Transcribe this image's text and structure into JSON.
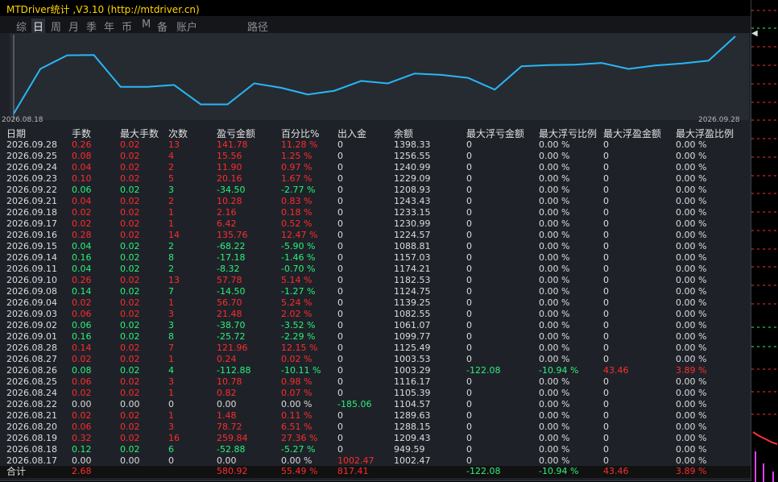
{
  "title": "MTDriver统计 ,V3.10 (http://mtdriver.cn)",
  "tabs": [
    "综",
    "日",
    "周",
    "月",
    "季",
    "年",
    "币",
    "M",
    "备",
    "账户",
    "路径"
  ],
  "active_tab": 1,
  "chart": {
    "date_start": "2026.08.18",
    "date_end": "2026.09.28",
    "line_color": "#29b6f6"
  },
  "colors": {
    "positive": "#ff2b2b",
    "negative": "#2cf07a",
    "neutral": "#dcdcdc"
  },
  "columns": [
    "日期",
    "手数",
    "最大手数",
    "次数",
    "盈亏金额",
    "百分比%",
    "出入金",
    "余额",
    "最大浮亏金额",
    "最大浮亏比例",
    "最大浮盈金额",
    "最大浮盈比例"
  ],
  "rows": [
    [
      "2026.09.28",
      "0.26",
      "0.02",
      "13",
      "141.78",
      "11.28 %",
      "0",
      "1398.33",
      "0",
      "0.00 %",
      "0",
      "0.00 %"
    ],
    [
      "2026.09.25",
      "0.08",
      "0.02",
      "4",
      "15.56",
      "1.25 %",
      "0",
      "1256.55",
      "0",
      "0.00 %",
      "0",
      "0.00 %"
    ],
    [
      "2026.09.24",
      "0.04",
      "0.02",
      "2",
      "11.90",
      "0.97 %",
      "0",
      "1240.99",
      "0",
      "0.00 %",
      "0",
      "0.00 %"
    ],
    [
      "2026.09.23",
      "0.10",
      "0.02",
      "5",
      "20.16",
      "1.67 %",
      "0",
      "1229.09",
      "0",
      "0.00 %",
      "0",
      "0.00 %"
    ],
    [
      "2026.09.22",
      "0.06",
      "0.02",
      "3",
      "-34.50",
      "-2.77 %",
      "0",
      "1208.93",
      "0",
      "0.00 %",
      "0",
      "0.00 %"
    ],
    [
      "2026.09.21",
      "0.04",
      "0.02",
      "2",
      "10.28",
      "0.83 %",
      "0",
      "1243.43",
      "0",
      "0.00 %",
      "0",
      "0.00 %"
    ],
    [
      "2026.09.18",
      "0.02",
      "0.02",
      "1",
      "2.16",
      "0.18 %",
      "0",
      "1233.15",
      "0",
      "0.00 %",
      "0",
      "0.00 %"
    ],
    [
      "2026.09.17",
      "0.02",
      "0.02",
      "1",
      "6.42",
      "0.52 %",
      "0",
      "1230.99",
      "0",
      "0.00 %",
      "0",
      "0.00 %"
    ],
    [
      "2026.09.16",
      "0.28",
      "0.02",
      "14",
      "135.76",
      "12.47 %",
      "0",
      "1224.57",
      "0",
      "0.00 %",
      "0",
      "0.00 %"
    ],
    [
      "2026.09.15",
      "0.04",
      "0.02",
      "2",
      "-68.22",
      "-5.90 %",
      "0",
      "1088.81",
      "0",
      "0.00 %",
      "0",
      "0.00 %"
    ],
    [
      "2026.09.14",
      "0.16",
      "0.02",
      "8",
      "-17.18",
      "-1.46 %",
      "0",
      "1157.03",
      "0",
      "0.00 %",
      "0",
      "0.00 %"
    ],
    [
      "2026.09.11",
      "0.04",
      "0.02",
      "2",
      "-8.32",
      "-0.70 %",
      "0",
      "1174.21",
      "0",
      "0.00 %",
      "0",
      "0.00 %"
    ],
    [
      "2026.09.10",
      "0.26",
      "0.02",
      "13",
      "57.78",
      "5.14 %",
      "0",
      "1182.53",
      "0",
      "0.00 %",
      "0",
      "0.00 %"
    ],
    [
      "2026.09.08",
      "0.14",
      "0.02",
      "7",
      "-14.50",
      "-1.27 %",
      "0",
      "1124.75",
      "0",
      "0.00 %",
      "0",
      "0.00 %"
    ],
    [
      "2026.09.04",
      "0.02",
      "0.02",
      "1",
      "56.70",
      "5.24 %",
      "0",
      "1139.25",
      "0",
      "0.00 %",
      "0",
      "0.00 %"
    ],
    [
      "2026.09.03",
      "0.06",
      "0.02",
      "3",
      "21.48",
      "2.02 %",
      "0",
      "1082.55",
      "0",
      "0.00 %",
      "0",
      "0.00 %"
    ],
    [
      "2026.09.02",
      "0.06",
      "0.02",
      "3",
      "-38.70",
      "-3.52 %",
      "0",
      "1061.07",
      "0",
      "0.00 %",
      "0",
      "0.00 %"
    ],
    [
      "2026.09.01",
      "0.16",
      "0.02",
      "8",
      "-25.72",
      "-2.29 %",
      "0",
      "1099.77",
      "0",
      "0.00 %",
      "0",
      "0.00 %"
    ],
    [
      "2026.08.28",
      "0.14",
      "0.02",
      "7",
      "121.96",
      "12.15 %",
      "0",
      "1125.49",
      "0",
      "0.00 %",
      "0",
      "0.00 %"
    ],
    [
      "2026.08.27",
      "0.02",
      "0.02",
      "1",
      "0.24",
      "0.02 %",
      "0",
      "1003.53",
      "0",
      "0.00 %",
      "0",
      "0.00 %"
    ],
    [
      "2026.08.26",
      "0.08",
      "0.02",
      "4",
      "-112.88",
      "-10.11 %",
      "0",
      "1003.29",
      "-122.08",
      "-10.94 %",
      "43.46",
      "3.89 %"
    ],
    [
      "2026.08.25",
      "0.06",
      "0.02",
      "3",
      "10.78",
      "0.98 %",
      "0",
      "1116.17",
      "0",
      "0.00 %",
      "0",
      "0.00 %"
    ],
    [
      "2026.08.24",
      "0.02",
      "0.02",
      "1",
      "0.82",
      "0.07 %",
      "0",
      "1105.39",
      "0",
      "0.00 %",
      "0",
      "0.00 %"
    ],
    [
      "2026.08.22",
      "0.00",
      "0.00",
      "0",
      "0.00",
      "0.00 %",
      "-185.06",
      "1104.57",
      "0",
      "0.00 %",
      "0",
      "0.00 %"
    ],
    [
      "2026.08.21",
      "0.02",
      "0.02",
      "1",
      "1.48",
      "0.11 %",
      "0",
      "1289.63",
      "0",
      "0.00 %",
      "0",
      "0.00 %"
    ],
    [
      "2026.08.20",
      "0.06",
      "0.02",
      "3",
      "78.72",
      "6.51 %",
      "0",
      "1288.15",
      "0",
      "0.00 %",
      "0",
      "0.00 %"
    ],
    [
      "2026.08.19",
      "0.32",
      "0.02",
      "16",
      "259.84",
      "27.36 %",
      "0",
      "1209.43",
      "0",
      "0.00 %",
      "0",
      "0.00 %"
    ],
    [
      "2026.08.18",
      "0.12",
      "0.02",
      "6",
      "-52.88",
      "-5.27 %",
      "0",
      "949.59",
      "0",
      "0.00 %",
      "0",
      "0.00 %"
    ],
    [
      "2026.08.17",
      "0.00",
      "0.00",
      "0",
      "0.00",
      "0.00 %",
      "1002.47",
      "1002.47",
      "0",
      "0.00 %",
      "0",
      "0.00 %"
    ]
  ],
  "total": [
    "合计",
    "2.68",
    "",
    "",
    "580.92",
    "55.49 %",
    "817.41",
    "",
    "-122.08",
    "-10.94 %",
    "43.46",
    "3.89 %"
  ]
}
